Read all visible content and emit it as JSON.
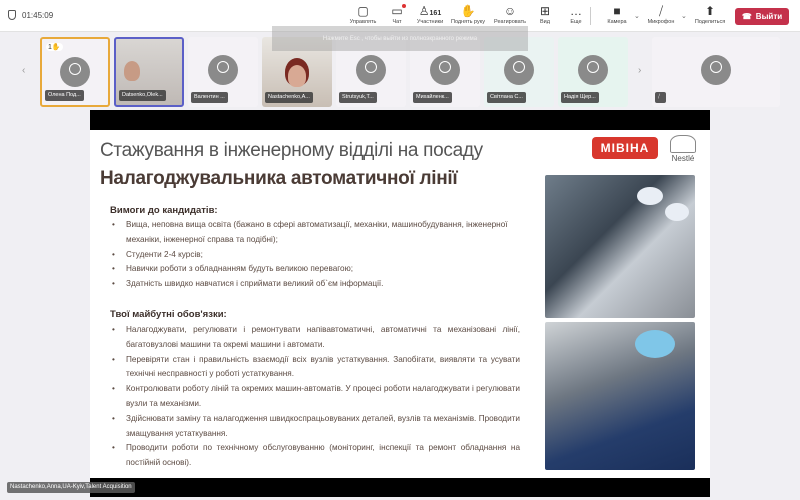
{
  "header": {
    "timer": "01:45:09",
    "participants_count": "161",
    "toolbar": [
      {
        "id": "manage",
        "label": "Управлять",
        "icon": "share-screen-icon"
      },
      {
        "id": "chat",
        "label": "Чат",
        "icon": "chat-icon"
      },
      {
        "id": "people",
        "label": "Участники",
        "icon": "people-icon"
      },
      {
        "id": "raise-hand",
        "label": "Поднять руку",
        "icon": "hand-icon"
      },
      {
        "id": "react",
        "label": "Реагировать",
        "icon": "smile-icon"
      },
      {
        "id": "view",
        "label": "Вид",
        "icon": "grid-icon"
      },
      {
        "id": "more",
        "label": "Еще",
        "icon": "more-icon"
      },
      {
        "id": "camera",
        "label": "Камера",
        "icon": "camera-off-icon"
      },
      {
        "id": "mic",
        "label": "Микрофон",
        "icon": "mic-off-icon"
      },
      {
        "id": "share",
        "label": "Поделиться",
        "icon": "share-icon"
      }
    ],
    "leave_label": "Выйти"
  },
  "fullscreen_toast": "Нажмите  Esc , чтобы выйти из полноэкранного режима",
  "participants": [
    {
      "name": "Олена Под...",
      "raised_hand": "1"
    },
    {
      "name": "Datsenko,Olek..."
    },
    {
      "name": "Валентин ..."
    },
    {
      "name": "Nastachenko,A..."
    },
    {
      "name": "Strutsyuk,T..."
    },
    {
      "name": "Михайленк..."
    },
    {
      "name": "Світлана С..."
    },
    {
      "name": "Надія Щер..."
    },
    {
      "name": ""
    }
  ],
  "slide": {
    "title_line1": "Стажування в інженерному відділі на посаду",
    "title_line2": "Налагоджувальника автоматичної лінії",
    "logo_mivina": "МІВІНА",
    "logo_nestle": "Nestlé",
    "requirements_heading": "Вимоги до кандидатів:",
    "requirements": [
      "Вища, неповна вища освіта (бажано в сфері автоматизації, механіки, машинобудування, інженерної механіки, інженерної справа та подібні);",
      "Студенти 2-4 курсів;",
      "Навички роботи з обладнанням будуть великою перевагою;",
      "Здатність швидко навчатися і сприймати великий об`єм інформації."
    ],
    "duties_heading": "Твої майбутні обов'язки:",
    "duties": [
      "Налагоджувати, регулювати і ремонтувати напівавтоматичні, автоматичні та механізовані лінії, багатовузлові машини та окремі машини і автомати.",
      "Перевіряти стан і правильність взаємодії всіх вузлів устаткування. Запобігати, виявляти та усувати технічні несправності у роботі устаткування.",
      "Контролювати роботу ліній та окремих машин-автоматів. У процесі роботи налагоджувати і регулювати вузли та механізми.",
      "Здійснювати заміну та налагодження швидкоспрацьовуваних деталей, вузлів та механізмів. Проводити змащування устаткування.",
      "Проводити роботи по технічному обслуговуванню (моніторинг, інспекції та ремонт обладнання на постійній основі)."
    ]
  },
  "presenter_caption": "Nastachenko,Anna,UA-Kyiv,Talent Acquisition"
}
